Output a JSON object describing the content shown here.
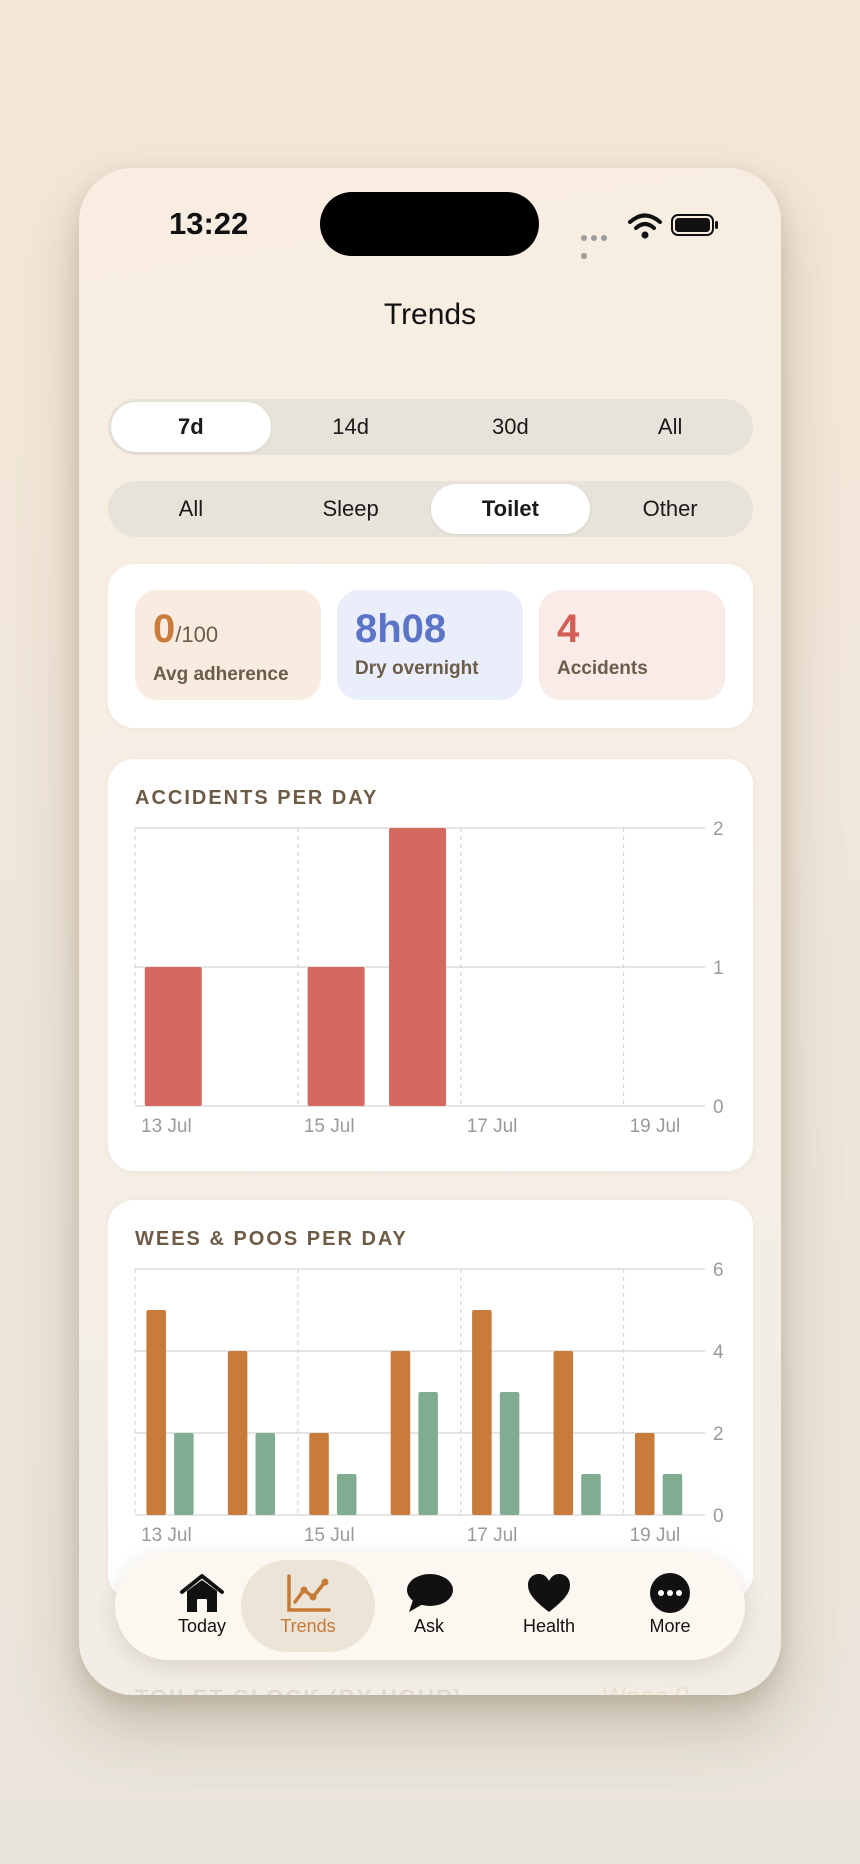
{
  "status": {
    "time": "13:22"
  },
  "page": {
    "title": "Trends"
  },
  "range_tabs": [
    {
      "label": "7d",
      "selected": true
    },
    {
      "label": "14d",
      "selected": false
    },
    {
      "label": "30d",
      "selected": false
    },
    {
      "label": "All",
      "selected": false
    }
  ],
  "category_tabs": [
    {
      "label": "All",
      "selected": false
    },
    {
      "label": "Sleep",
      "selected": false
    },
    {
      "label": "Toilet",
      "selected": true
    },
    {
      "label": "Other",
      "selected": false
    }
  ],
  "stats": [
    {
      "value": "0",
      "suffix": "/100",
      "label": "Avg adherence",
      "color": "#c97b3b",
      "bg": "#f8ece1"
    },
    {
      "value": "8h08",
      "suffix": "",
      "label": "Dry overnight",
      "color": "#5b74c7",
      "bg": "#e9eefa"
    },
    {
      "value": "4",
      "suffix": "",
      "label": "Accidents",
      "color": "#d15f55",
      "bg": "#f9ebe8"
    }
  ],
  "chart_data": [
    {
      "type": "bar",
      "title": "ACCIDENTS PER DAY",
      "categories": [
        "13 Jul",
        "14 Jul",
        "15 Jul",
        "16 Jul",
        "17 Jul",
        "18 Jul",
        "19 Jul"
      ],
      "x_tick_labels": [
        "13 Jul",
        "15 Jul",
        "17 Jul",
        "19 Jul"
      ],
      "values": [
        1,
        0,
        1,
        2,
        0,
        0,
        0
      ],
      "ylim": [
        0,
        2
      ],
      "y_ticks": [
        0,
        1,
        2
      ],
      "color": "#d3695f",
      "grid": true
    },
    {
      "type": "bar",
      "title": "WEES & POOS PER DAY",
      "categories": [
        "13 Jul",
        "14 Jul",
        "15 Jul",
        "16 Jul",
        "17 Jul",
        "18 Jul",
        "19 Jul"
      ],
      "x_tick_labels": [
        "13 Jul",
        "15 Jul",
        "17 Jul",
        "19 Jul"
      ],
      "series": [
        {
          "values": [
            5,
            4,
            2,
            4,
            5,
            4,
            2
          ],
          "color": "#c97b3b"
        },
        {
          "values": [
            2,
            2,
            1,
            3,
            3,
            1,
            1
          ],
          "color": "#80ad92"
        }
      ],
      "ylim": [
        0,
        6
      ],
      "y_ticks": [
        0,
        2,
        4,
        6
      ],
      "grid": true
    }
  ],
  "tabbar": [
    {
      "label": "Today",
      "icon": "house-icon",
      "selected": false
    },
    {
      "label": "Trends",
      "icon": "trend-chart-icon",
      "selected": true
    },
    {
      "label": "Ask",
      "icon": "speech-bubble-icon",
      "selected": false
    },
    {
      "label": "Health",
      "icon": "heart-icon",
      "selected": false
    },
    {
      "label": "More",
      "icon": "more-dots-icon",
      "selected": false
    }
  ],
  "partial_section": {
    "title": "TOILET CLOCK (BY HOUR)",
    "aside": "Wees 0"
  }
}
